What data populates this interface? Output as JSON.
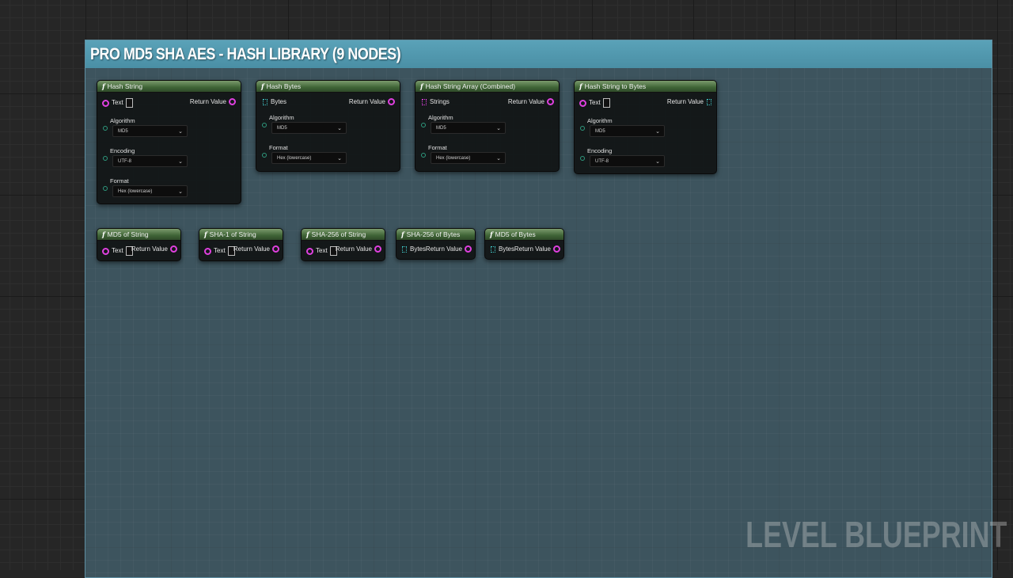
{
  "comment": {
    "title": "PRO MD5 SHA AES - HASH LIBRARY (9 NODES)"
  },
  "watermark": "LEVEL BLUEPRINT",
  "nodes": {
    "hash_string": {
      "title": "Hash String",
      "input": "Text",
      "output": "Return Value",
      "algorithm_label": "Algorithm",
      "algorithm_value": "MD5",
      "encoding_label": "Encoding",
      "encoding_value": "UTF-8",
      "format_label": "Format",
      "format_value": "Hex (lowercase)"
    },
    "hash_bytes": {
      "title": "Hash Bytes",
      "input": "Bytes",
      "output": "Return Value",
      "algorithm_label": "Algorithm",
      "algorithm_value": "MD5",
      "format_label": "Format",
      "format_value": "Hex (lowercase)"
    },
    "hash_string_array": {
      "title": "Hash String Array (Combined)",
      "input": "Strings",
      "output": "Return Value",
      "algorithm_label": "Algorithm",
      "algorithm_value": "MD5",
      "format_label": "Format",
      "format_value": "Hex (lowercase)"
    },
    "hash_string_to_bytes": {
      "title": "Hash String to Bytes",
      "input": "Text",
      "output": "Return Value",
      "algorithm_label": "Algorithm",
      "algorithm_value": "MD5",
      "encoding_label": "Encoding",
      "encoding_value": "UTF-8"
    },
    "md5_of_string": {
      "title": "MD5 of String",
      "input": "Text",
      "output": "Return Value"
    },
    "sha1_of_string": {
      "title": "SHA-1 of String",
      "input": "Text",
      "output": "Return Value"
    },
    "sha256_of_string": {
      "title": "SHA-256 of String",
      "input": "Text",
      "output": "Return Value"
    },
    "sha256_of_bytes": {
      "title": "SHA-256 of Bytes",
      "input": "Bytes",
      "output": "Return Value"
    },
    "md5_of_bytes": {
      "title": "MD5 of Bytes",
      "input": "Bytes",
      "output": "Return Value"
    }
  }
}
